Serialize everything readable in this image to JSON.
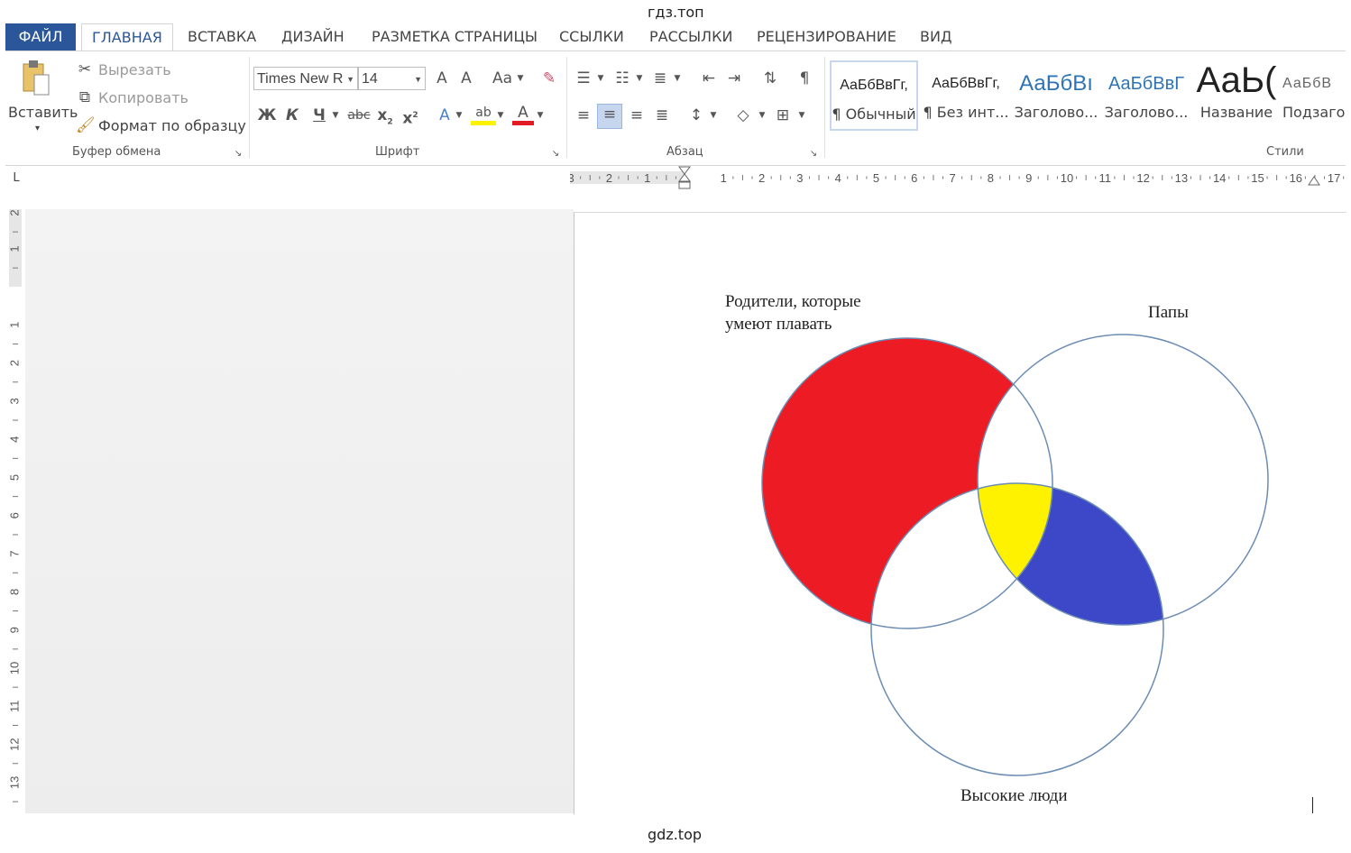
{
  "watermark_top": "гдз.топ",
  "watermark_bottom": "gdz.top",
  "tabs": [
    {
      "label": "ФАЙЛ"
    },
    {
      "label": "ГЛАВНАЯ"
    },
    {
      "label": "ВСТАВКА"
    },
    {
      "label": "ДИЗАЙН"
    },
    {
      "label": "РАЗМЕТКА СТРАНИЦЫ"
    },
    {
      "label": "ССЫЛКИ"
    },
    {
      "label": "РАССЫЛКИ"
    },
    {
      "label": "РЕЦЕНЗИРОВАНИЕ"
    },
    {
      "label": "ВИД"
    }
  ],
  "clipboard": {
    "paste": "Вставить",
    "cut": "Вырезать",
    "copy": "Копировать",
    "format_painter": "Формат по образцу",
    "group": "Буфер обмена"
  },
  "font": {
    "name": "Times New R",
    "size": "14",
    "grow": "A",
    "shrink": "A",
    "case": "Aa",
    "bold": "Ж",
    "italic": "К",
    "underline": "Ч",
    "strike": "abc",
    "subscript": "x",
    "superscript": "x",
    "effects": "A",
    "highlight": "ab",
    "color": "A",
    "group": "Шрифт"
  },
  "paragraph": {
    "group": "Абзац",
    "pilcrow": "¶"
  },
  "styles": {
    "group": "Стили",
    "items": [
      {
        "preview": "АаБбВвГг,",
        "name": "¶ Обычный"
      },
      {
        "preview": "АаБбВвГг,",
        "name": "¶ Без инт..."
      },
      {
        "preview": "АаБбВı",
        "name": "Заголово..."
      },
      {
        "preview": "АаБбВвГ",
        "name": "Заголово..."
      },
      {
        "preview": "АаЬ(",
        "name": "Название"
      },
      {
        "preview": "АаБбВ",
        "name": "Подзаго"
      }
    ]
  },
  "ruler": {
    "corner": "L",
    "h_ticks": [
      "3",
      "2",
      "1",
      "1",
      "2",
      "3",
      "4",
      "5",
      "6",
      "7",
      "8",
      "9",
      "10",
      "11",
      "12",
      "13",
      "14",
      "15",
      "16",
      "17"
    ],
    "v_ticks": [
      "2",
      "1",
      "1",
      "2",
      "3",
      "4",
      "5",
      "6",
      "7",
      "8",
      "9",
      "10",
      "11",
      "12",
      "13"
    ]
  },
  "venn": {
    "sets": [
      {
        "label_line1": "Родители, которые",
        "label_line2": "умеют плавать",
        "color": "#ed1c24"
      },
      {
        "label_line1": "Папы",
        "color": "#ffffff"
      },
      {
        "label_line1": "Высокие люди",
        "color": "#ffffff"
      }
    ],
    "regions": [
      {
        "name": "only-swimming-parents",
        "color": "#ed1c24"
      },
      {
        "name": "all-three",
        "color": "#fff200"
      },
      {
        "name": "dads-and-tall",
        "color": "#3c48c8"
      }
    ],
    "stroke": "#6b8cb3"
  }
}
